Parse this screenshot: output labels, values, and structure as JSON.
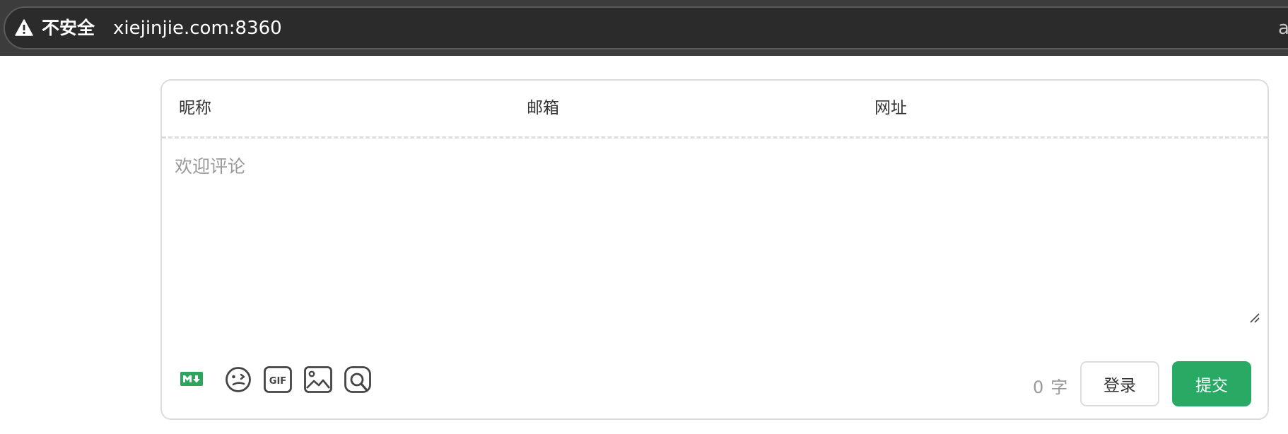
{
  "browser": {
    "security_label": "不安全",
    "url": "xiejinjie.com:8360",
    "clipped_char": "a",
    "colors": {
      "bar": "#3c3c3c",
      "pill": "#2b2b2b",
      "text": "#ffffff"
    }
  },
  "comment_form": {
    "nickname_placeholder": "昵称",
    "email_placeholder": "邮箱",
    "website_placeholder": "网址",
    "comment_placeholder": "欢迎评论",
    "toolbar_icons": [
      "markdown-icon",
      "emoji-icon",
      "gif-icon",
      "image-icon",
      "preview-icon"
    ],
    "word_count": "0",
    "word_count_unit": "字",
    "login_label": "登录",
    "submit_label": "提交",
    "colors": {
      "accent": "#28a964",
      "markdown_icon": "#2ea55e",
      "border": "#dcdcdc"
    }
  }
}
